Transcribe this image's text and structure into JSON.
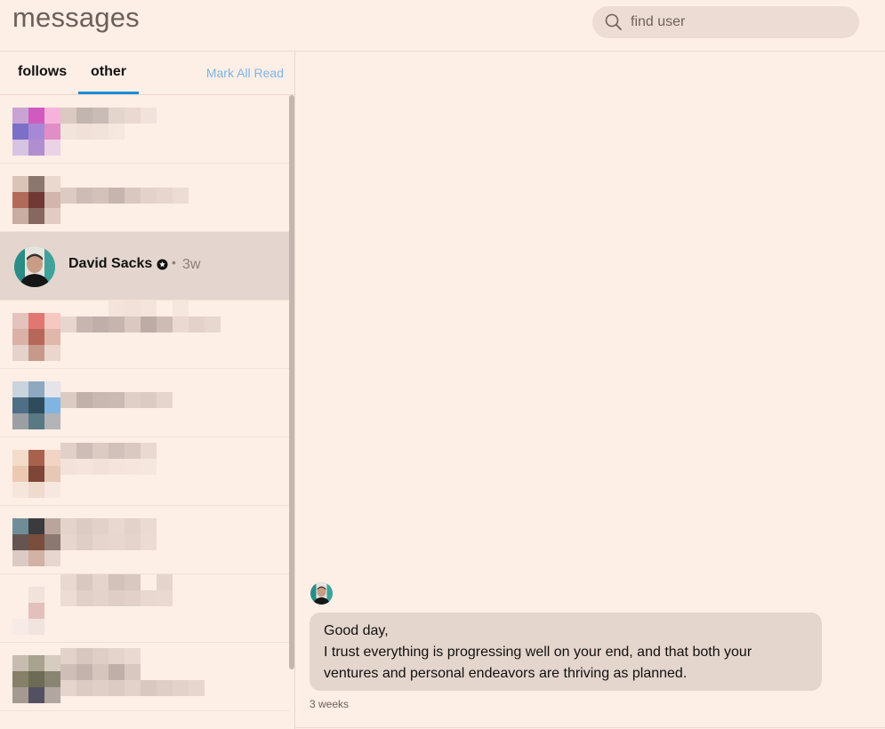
{
  "header": {
    "title": "messages",
    "search": {
      "placeholder": "find user",
      "value": ""
    }
  },
  "tabs": {
    "follows": "follows",
    "other": "other",
    "active": "other",
    "mark_all_read": "Mark All Read"
  },
  "conversations": {
    "active": {
      "name": "David Sacks",
      "separator": "•",
      "time_ago": "3w"
    }
  },
  "thread": {
    "messages": [
      {
        "lines": [
          "Good day,",
          "I trust everything is progressing well on your end, and that both your",
          "ventures and personal endeavors are thriving as planned."
        ],
        "time": "3 weeks"
      }
    ]
  },
  "colors": {
    "background": "#fdeee6",
    "active_row": "#e4d6ce",
    "accent": "#1a8bd6",
    "link": "#7bb6e0"
  }
}
